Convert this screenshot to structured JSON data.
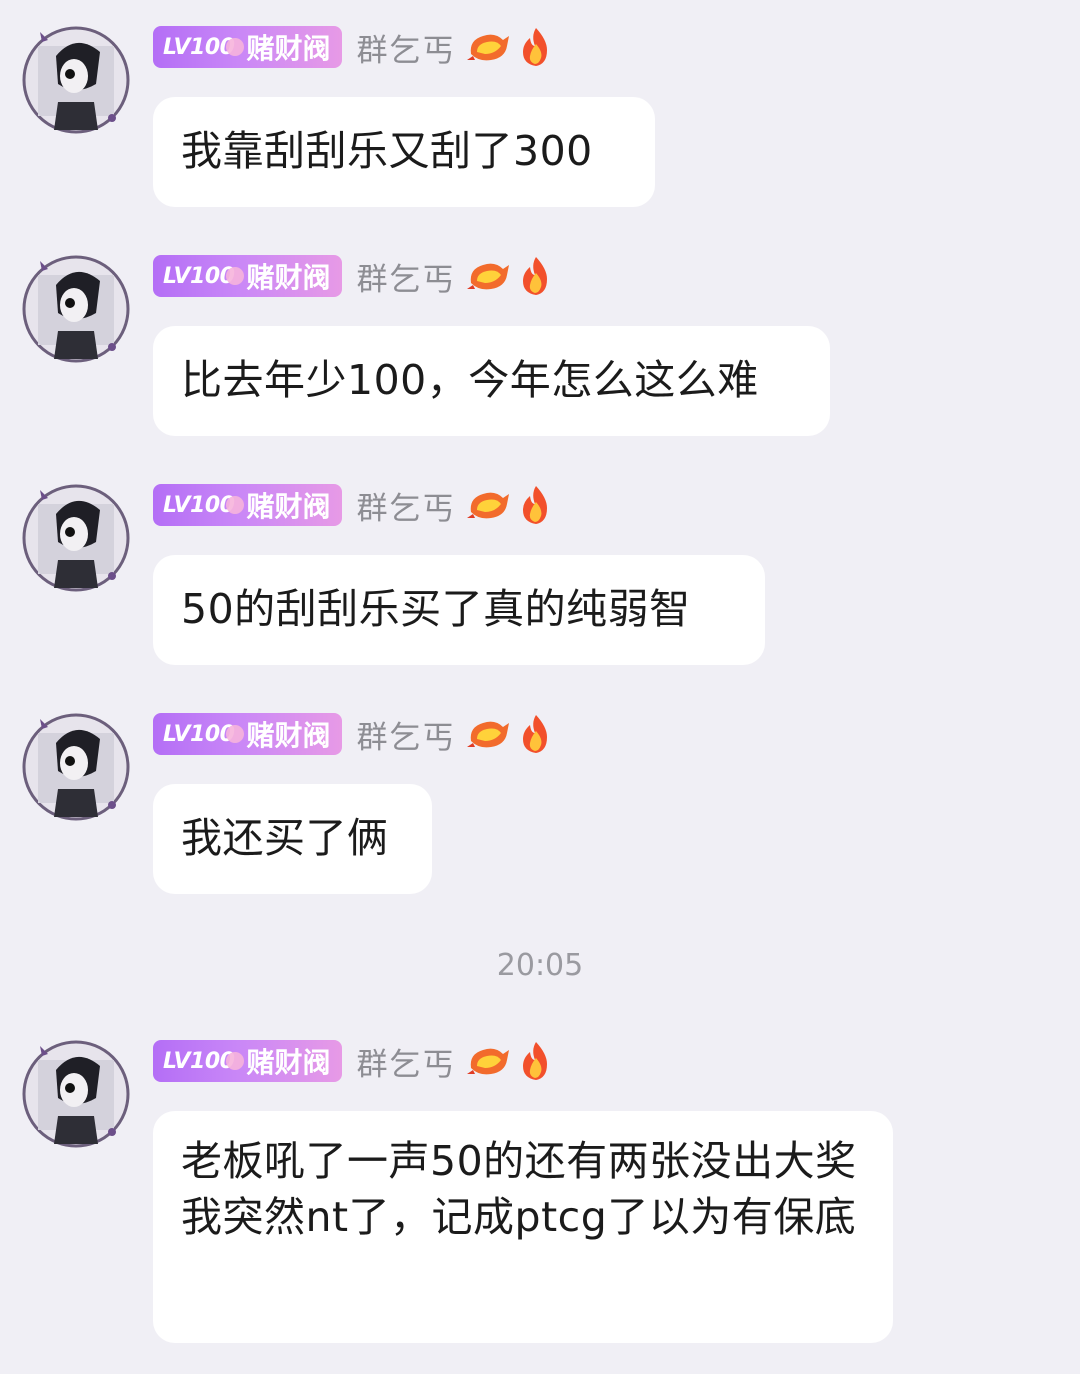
{
  "sender": {
    "level": "LV100",
    "title": "赌财阀",
    "nickname": "群乞丐",
    "badge_icons": [
      "dragon-icon",
      "fire-icon"
    ],
    "badge_colors": {
      "start": "#b46ef6",
      "end": "#e79ae6"
    }
  },
  "messages": [
    {
      "text": "我靠刮刮乐又刮了300"
    },
    {
      "text": "比去年少100，今年怎么这么难"
    },
    {
      "text": "50的刮刮乐买了真的纯弱智"
    },
    {
      "text": "我还买了俩"
    },
    {
      "text": "老板吼了一声50的还有两张没出大奖我突然nt了，记成ptcg了以为有保底"
    }
  ],
  "time_divider": "20:05"
}
